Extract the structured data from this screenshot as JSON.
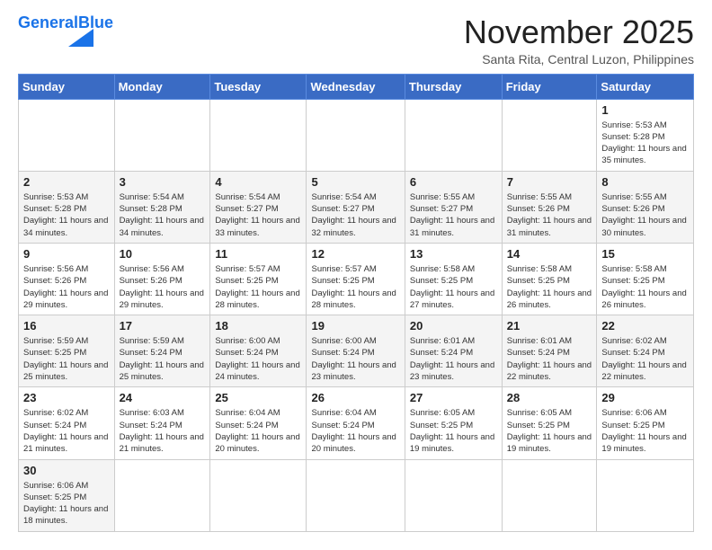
{
  "header": {
    "logo_general": "General",
    "logo_blue": "Blue",
    "month_title": "November 2025",
    "location": "Santa Rita, Central Luzon, Philippines"
  },
  "weekdays": [
    "Sunday",
    "Monday",
    "Tuesday",
    "Wednesday",
    "Thursday",
    "Friday",
    "Saturday"
  ],
  "weeks": [
    [
      {
        "day": "",
        "info": ""
      },
      {
        "day": "",
        "info": ""
      },
      {
        "day": "",
        "info": ""
      },
      {
        "day": "",
        "info": ""
      },
      {
        "day": "",
        "info": ""
      },
      {
        "day": "",
        "info": ""
      },
      {
        "day": "1",
        "info": "Sunrise: 5:53 AM\nSunset: 5:28 PM\nDaylight: 11 hours and 35 minutes."
      }
    ],
    [
      {
        "day": "2",
        "info": "Sunrise: 5:53 AM\nSunset: 5:28 PM\nDaylight: 11 hours and 34 minutes."
      },
      {
        "day": "3",
        "info": "Sunrise: 5:54 AM\nSunset: 5:28 PM\nDaylight: 11 hours and 34 minutes."
      },
      {
        "day": "4",
        "info": "Sunrise: 5:54 AM\nSunset: 5:27 PM\nDaylight: 11 hours and 33 minutes."
      },
      {
        "day": "5",
        "info": "Sunrise: 5:54 AM\nSunset: 5:27 PM\nDaylight: 11 hours and 32 minutes."
      },
      {
        "day": "6",
        "info": "Sunrise: 5:55 AM\nSunset: 5:27 PM\nDaylight: 11 hours and 31 minutes."
      },
      {
        "day": "7",
        "info": "Sunrise: 5:55 AM\nSunset: 5:26 PM\nDaylight: 11 hours and 31 minutes."
      },
      {
        "day": "8",
        "info": "Sunrise: 5:55 AM\nSunset: 5:26 PM\nDaylight: 11 hours and 30 minutes."
      }
    ],
    [
      {
        "day": "9",
        "info": "Sunrise: 5:56 AM\nSunset: 5:26 PM\nDaylight: 11 hours and 29 minutes."
      },
      {
        "day": "10",
        "info": "Sunrise: 5:56 AM\nSunset: 5:26 PM\nDaylight: 11 hours and 29 minutes."
      },
      {
        "day": "11",
        "info": "Sunrise: 5:57 AM\nSunset: 5:25 PM\nDaylight: 11 hours and 28 minutes."
      },
      {
        "day": "12",
        "info": "Sunrise: 5:57 AM\nSunset: 5:25 PM\nDaylight: 11 hours and 28 minutes."
      },
      {
        "day": "13",
        "info": "Sunrise: 5:58 AM\nSunset: 5:25 PM\nDaylight: 11 hours and 27 minutes."
      },
      {
        "day": "14",
        "info": "Sunrise: 5:58 AM\nSunset: 5:25 PM\nDaylight: 11 hours and 26 minutes."
      },
      {
        "day": "15",
        "info": "Sunrise: 5:58 AM\nSunset: 5:25 PM\nDaylight: 11 hours and 26 minutes."
      }
    ],
    [
      {
        "day": "16",
        "info": "Sunrise: 5:59 AM\nSunset: 5:25 PM\nDaylight: 11 hours and 25 minutes."
      },
      {
        "day": "17",
        "info": "Sunrise: 5:59 AM\nSunset: 5:24 PM\nDaylight: 11 hours and 25 minutes."
      },
      {
        "day": "18",
        "info": "Sunrise: 6:00 AM\nSunset: 5:24 PM\nDaylight: 11 hours and 24 minutes."
      },
      {
        "day": "19",
        "info": "Sunrise: 6:00 AM\nSunset: 5:24 PM\nDaylight: 11 hours and 23 minutes."
      },
      {
        "day": "20",
        "info": "Sunrise: 6:01 AM\nSunset: 5:24 PM\nDaylight: 11 hours and 23 minutes."
      },
      {
        "day": "21",
        "info": "Sunrise: 6:01 AM\nSunset: 5:24 PM\nDaylight: 11 hours and 22 minutes."
      },
      {
        "day": "22",
        "info": "Sunrise: 6:02 AM\nSunset: 5:24 PM\nDaylight: 11 hours and 22 minutes."
      }
    ],
    [
      {
        "day": "23",
        "info": "Sunrise: 6:02 AM\nSunset: 5:24 PM\nDaylight: 11 hours and 21 minutes."
      },
      {
        "day": "24",
        "info": "Sunrise: 6:03 AM\nSunset: 5:24 PM\nDaylight: 11 hours and 21 minutes."
      },
      {
        "day": "25",
        "info": "Sunrise: 6:04 AM\nSunset: 5:24 PM\nDaylight: 11 hours and 20 minutes."
      },
      {
        "day": "26",
        "info": "Sunrise: 6:04 AM\nSunset: 5:24 PM\nDaylight: 11 hours and 20 minutes."
      },
      {
        "day": "27",
        "info": "Sunrise: 6:05 AM\nSunset: 5:25 PM\nDaylight: 11 hours and 19 minutes."
      },
      {
        "day": "28",
        "info": "Sunrise: 6:05 AM\nSunset: 5:25 PM\nDaylight: 11 hours and 19 minutes."
      },
      {
        "day": "29",
        "info": "Sunrise: 6:06 AM\nSunset: 5:25 PM\nDaylight: 11 hours and 19 minutes."
      }
    ],
    [
      {
        "day": "30",
        "info": "Sunrise: 6:06 AM\nSunset: 5:25 PM\nDaylight: 11 hours and 18 minutes."
      },
      {
        "day": "",
        "info": ""
      },
      {
        "day": "",
        "info": ""
      },
      {
        "day": "",
        "info": ""
      },
      {
        "day": "",
        "info": ""
      },
      {
        "day": "",
        "info": ""
      },
      {
        "day": "",
        "info": ""
      }
    ]
  ]
}
